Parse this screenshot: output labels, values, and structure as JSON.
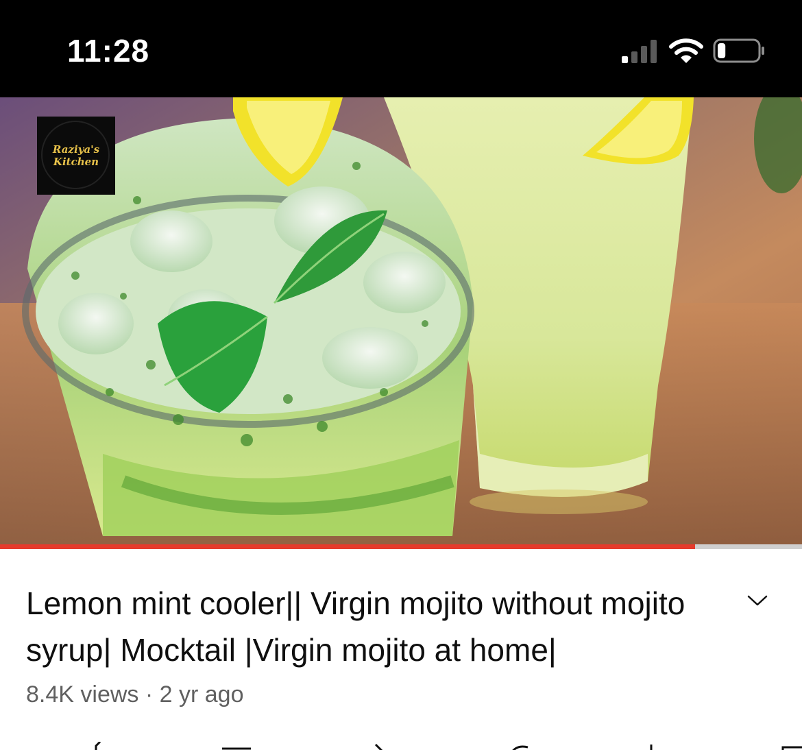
{
  "status_bar": {
    "time": "11:28",
    "signal_icon": "cellular-signal-icon",
    "wifi_icon": "wifi-icon",
    "battery_icon": "battery-icon",
    "battery_level": 0.2
  },
  "video": {
    "watermark": {
      "line1": "Raziya's",
      "line2": "Kitchen"
    },
    "progress": 0.867,
    "progress_color": "#e53b2c"
  },
  "details": {
    "title": "Lemon mint cooler|| Virgin mojito without mojito syrup| Mocktail |Virgin mojito at home|",
    "meta": "8.4K views · 2 yr ago",
    "expand_icon": "chevron-down-icon"
  },
  "actions": [
    {
      "icon": "like-icon"
    },
    {
      "icon": "dislike-icon"
    },
    {
      "icon": "share-icon"
    },
    {
      "icon": "remix-icon"
    },
    {
      "icon": "download-icon"
    },
    {
      "icon": "save-icon"
    }
  ]
}
